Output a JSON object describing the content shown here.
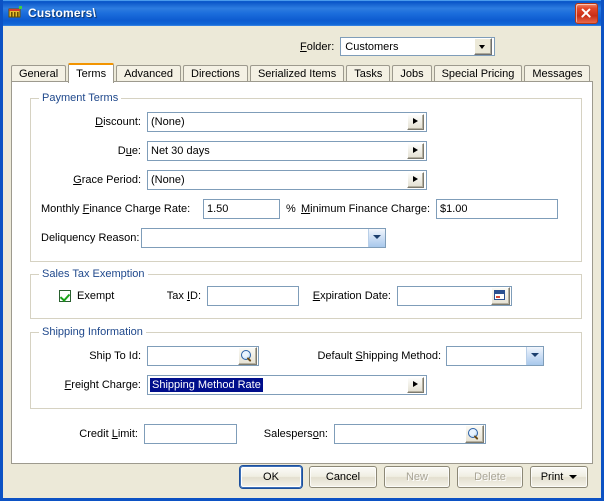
{
  "window": {
    "title": "Customers\\",
    "icon": "customers-app-icon",
    "close_label": "Close"
  },
  "header": {
    "folder_label": "Folder:",
    "folder_label_accel": "F",
    "folder_value": "Customers"
  },
  "tabs": [
    {
      "label": "General",
      "active": false
    },
    {
      "label": "Terms",
      "active": true
    },
    {
      "label": "Advanced",
      "active": false
    },
    {
      "label": "Directions",
      "active": false
    },
    {
      "label": "Serialized Items",
      "active": false
    },
    {
      "label": "Tasks",
      "active": false
    },
    {
      "label": "Jobs",
      "active": false
    },
    {
      "label": "Special Pricing",
      "active": false
    },
    {
      "label": "Messages",
      "active": false
    }
  ],
  "payment_terms": {
    "legend": "Payment Terms",
    "discount_label": "Discount:",
    "discount_value": "(None)",
    "due_label": "Due:",
    "due_value": "Net  30 days",
    "grace_label": "Grace Period:",
    "grace_value": "(None)",
    "monthly_rate_label": "Monthly Finance Charge Rate:",
    "monthly_rate_value": "1.50",
    "percent_symbol": "%",
    "min_charge_label": "Minimum Finance Charge:",
    "min_charge_value": "$1.00",
    "delinquency_label": "Deliquency Reason:",
    "delinquency_value": ""
  },
  "sales_tax": {
    "legend": "Sales Tax Exemption",
    "exempt_label": "Exempt",
    "exempt_checked": true,
    "tax_id_label": "Tax ID:",
    "tax_id_value": "",
    "expiration_label": "Expiration Date:",
    "expiration_value": ""
  },
  "shipping": {
    "legend": "Shipping Information",
    "ship_to_label": "Ship To Id:",
    "ship_to_value": "",
    "default_method_label": "Default Shipping Method:",
    "default_method_value": "",
    "freight_label": "Freight Charge:",
    "freight_value": "Shipping Method Rate",
    "freight_selected": true
  },
  "bottom_fields": {
    "credit_limit_label": "Credit Limit:",
    "credit_limit_value": "",
    "salesperson_label": "Salesperson:",
    "salesperson_value": ""
  },
  "buttons": {
    "ok": "OK",
    "cancel": "Cancel",
    "new": "New",
    "delete": "Delete",
    "print": "Print"
  },
  "colors": {
    "title_bar": "#0a56c8",
    "dialog_bg": "#ece9d8",
    "active_tab_accent": "#f29400",
    "group_legend": "#20498c",
    "field_border": "#7f9db9",
    "selection_bg": "#000e8c",
    "close_button": "#c92d15"
  }
}
